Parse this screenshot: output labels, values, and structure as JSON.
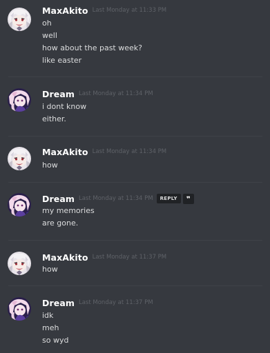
{
  "messages": [
    {
      "author": "MaxAkito",
      "timestamp": "Last Monday at 11:33 PM",
      "avatar": "maxakito-avatar",
      "lines": [
        "oh",
        "well",
        "how about the past week?",
        "like easter"
      ]
    },
    {
      "author": "Dream",
      "timestamp": "Last Monday at 11:34 PM",
      "avatar": "dream-avatar",
      "lines": [
        "i dont know",
        "either."
      ]
    },
    {
      "author": "MaxAkito",
      "timestamp": "Last Monday at 11:34 PM",
      "avatar": "maxakito-avatar",
      "lines": [
        "how"
      ]
    },
    {
      "author": "Dream",
      "timestamp": "Last Monday at 11:34 PM",
      "avatar": "dream-avatar",
      "lines": [
        "my memories",
        "are gone."
      ],
      "reply_label": "REPLY",
      "quote_label": "❞"
    },
    {
      "author": "MaxAkito",
      "timestamp": "Last Monday at 11:37 PM",
      "avatar": "maxakito-avatar",
      "lines": [
        "how"
      ]
    },
    {
      "author": "Dream",
      "timestamp": "Last Monday at 11:37 PM",
      "avatar": "dream-avatar",
      "lines": [
        "idk",
        "meh",
        "so wyd"
      ]
    }
  ],
  "colors": {
    "background": "#36393f",
    "username": "#ffffff",
    "message_text": "#dcddde",
    "timestamp": "#5f6268",
    "divider": "#3f4248"
  }
}
